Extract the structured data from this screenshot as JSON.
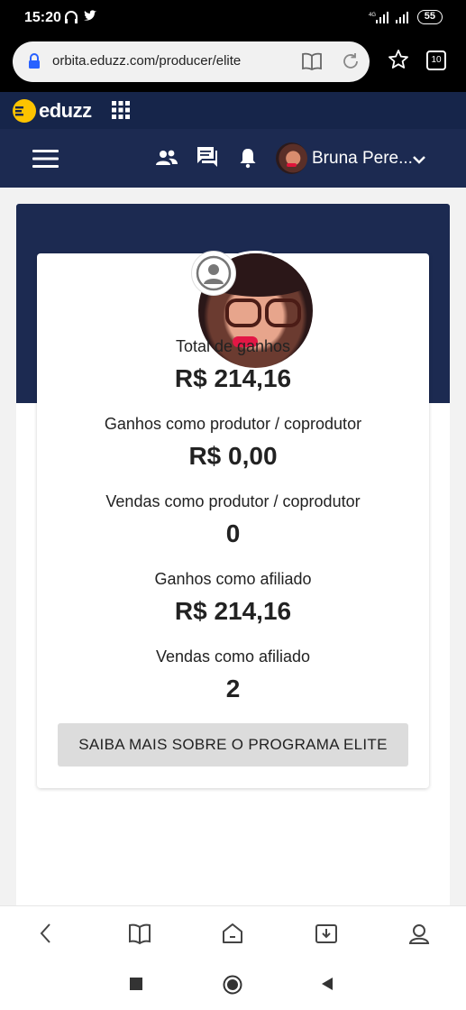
{
  "status_bar": {
    "time": "15:20",
    "network": "4G",
    "battery": "55"
  },
  "browser": {
    "url": "orbita.eduzz.com/producer/elite",
    "tab_count": "10"
  },
  "brand": {
    "name": "eduzz"
  },
  "header": {
    "user_name": "Bruna Pere..."
  },
  "stats": [
    {
      "label": "Total de ganhos",
      "value": "R$ 214,16"
    },
    {
      "label": "Ganhos como produtor / coprodutor",
      "value": "R$ 0,00"
    },
    {
      "label": "Vendas como produtor / coprodutor",
      "value": "0"
    },
    {
      "label": "Ganhos como afiliado",
      "value": "R$ 214,16"
    },
    {
      "label": "Vendas como afiliado",
      "value": "2"
    }
  ],
  "elite_button": {
    "label": "SAIBA MAIS SOBRE O PROGRAMA ELITE"
  },
  "colors": {
    "nav_dark": "#1c2a51",
    "brand_yellow": "#fdc300",
    "button_gray": "#dcdcdc"
  }
}
